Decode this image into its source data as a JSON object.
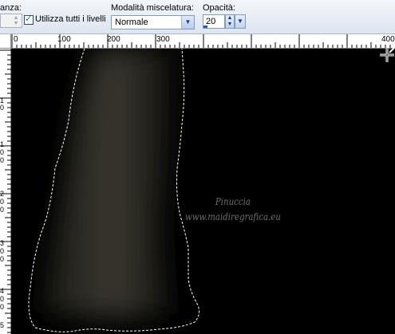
{
  "toolbar": {
    "partial_label": "anza:",
    "use_all_layers_label": "Utilizza tutti i livelli",
    "blend_mode_label": "Modalità miscelatura:",
    "blend_mode_value": "Normale",
    "opacity_label": "Opacità:",
    "opacity_value": "20",
    "opacity_fill_percent": 20
  },
  "ruler_top": {
    "labels": [
      "0",
      "100",
      "200",
      "300",
      "400"
    ]
  },
  "ruler_left": {
    "labels": [
      "1",
      "0",
      "1",
      "0",
      "0",
      "2",
      "0",
      "0",
      "3",
      "0",
      "0",
      "4",
      "0",
      "0",
      "5"
    ]
  },
  "canvas": {
    "background": "#000000",
    "selection_color": "#ffffff",
    "shape_color": "#35342c"
  },
  "watermark": {
    "line1": "Pinuccia",
    "line2": "www.maidiregrafica.eu"
  },
  "icons": {
    "cursor": "crosshair-cursor-icon"
  }
}
